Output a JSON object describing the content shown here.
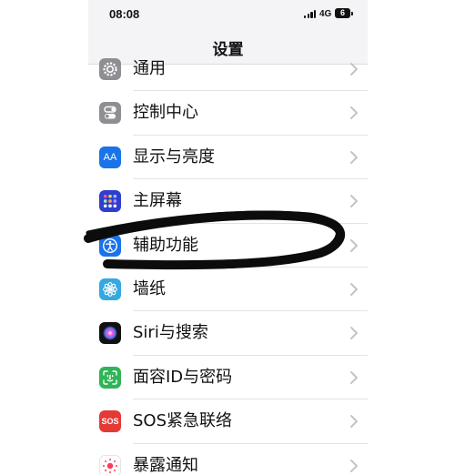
{
  "status": {
    "time": "08:08",
    "network": "4G",
    "battery": "6"
  },
  "header": {
    "title": "设置"
  },
  "settings": {
    "items": [
      {
        "label": "通用",
        "icon": "gear-icon",
        "color": "#8e8e93"
      },
      {
        "label": "控制中心",
        "icon": "toggle-switches-icon",
        "color": "#8e8e93"
      },
      {
        "label": "显示与亮度",
        "icon": "aa-text-icon",
        "color": "#1a73e8"
      },
      {
        "label": "主屏幕",
        "icon": "app-grid-icon",
        "color": "#2f3ecf"
      },
      {
        "label": "辅助功能",
        "icon": "accessibility-icon",
        "color": "#1a73e8"
      },
      {
        "label": "墙纸",
        "icon": "flower-icon",
        "color": "#35a8e0"
      },
      {
        "label": "Siri与搜索",
        "icon": "siri-icon",
        "color": "#111111"
      },
      {
        "label": "面容ID与密码",
        "icon": "face-id-icon",
        "color": "#2fb457"
      },
      {
        "label": "SOS紧急联络",
        "icon_text": "SOS",
        "icon": "sos-icon",
        "color": "#e53935"
      },
      {
        "label": "暴露通知",
        "icon": "exposure-icon",
        "color": "#ffffff"
      }
    ]
  }
}
